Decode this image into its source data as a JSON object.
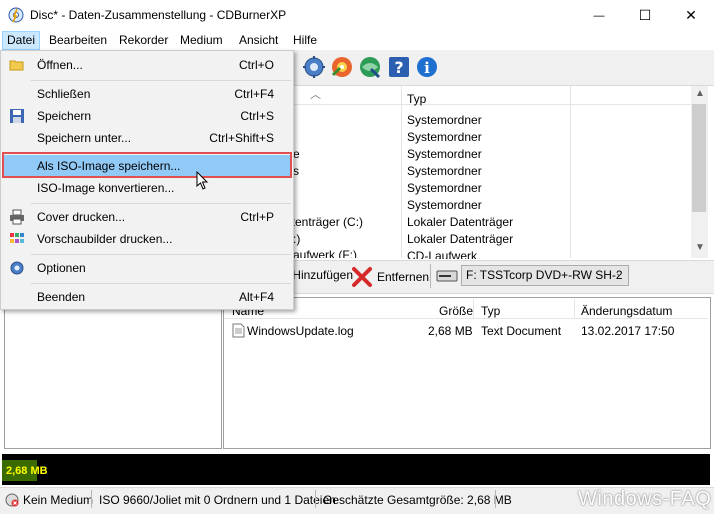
{
  "window": {
    "title": "Disc* - Daten-Zusammenstellung - CDBurnerXP",
    "minimize": "—",
    "maximize": "☐",
    "close": "✕"
  },
  "menubar": [
    "Datei",
    "Bearbeiten",
    "Rekorder",
    "Medium",
    "Ansicht",
    "Hilfe"
  ],
  "file_menu": [
    {
      "label": "Öffnen...",
      "shortcut": "Ctrl+O",
      "icon": "folder-icon"
    },
    {
      "label": "Schließen",
      "shortcut": "Ctrl+F4",
      "icon": ""
    },
    {
      "label": "Speichern",
      "shortcut": "Ctrl+S",
      "icon": "floppy-icon"
    },
    {
      "label": "Speichern unter...",
      "shortcut": "Ctrl+Shift+S",
      "icon": ""
    },
    {
      "label": "Als ISO-Image speichern...",
      "shortcut": "",
      "icon": ""
    },
    {
      "label": "ISO-Image konvertieren...",
      "shortcut": "",
      "icon": ""
    },
    {
      "label": "Cover drucken...",
      "shortcut": "Ctrl+P",
      "icon": "printer-icon"
    },
    {
      "label": "Vorschaubilder drucken...",
      "shortcut": "",
      "icon": "thumbnails-icon"
    },
    {
      "label": "Optionen",
      "shortcut": "",
      "icon": "gear-icon"
    },
    {
      "label": "Beenden",
      "shortcut": "Alt+F4",
      "icon": ""
    }
  ],
  "upper_list": {
    "column": "Typ",
    "types": [
      "Systemordner",
      "Systemordner",
      "Systemordner",
      "Systemordner",
      "Systemordner",
      "Systemordner",
      "Lokaler Datenträger",
      "Lokaler Datenträger",
      "CD-Laufwerk"
    ],
    "left_fragments": [
      "e",
      "s",
      "atenträger (C:)",
      ":)",
      "aufwerk (F:)"
    ]
  },
  "midbar": {
    "add_label": "Hinzufügen",
    "remove_label": "Entfernen",
    "drive": "F: TSSTcorp DVD+-RW SH-2"
  },
  "lower_list": {
    "headers": {
      "name": "Name",
      "size": "Größe",
      "type": "Typ",
      "date": "Änderungsdatum"
    },
    "rows": [
      {
        "name": "WindowsUpdate.log",
        "size": "2,68 MB",
        "type": "Text Document",
        "date": "13.02.2017 17:50"
      }
    ]
  },
  "capacity": {
    "label": "2,68 MB",
    "fill_fraction": 0.005
  },
  "status": {
    "medium": "Kein Medium",
    "fs": "ISO 9660/Joliet mit 0 Ordnern und 1 Dateien",
    "size": "Geschätzte Gesamtgröße: 2,68 MB"
  },
  "watermark": "Windows-FAQ",
  "colors": {
    "highlight": "#91c9f7",
    "callout": "#e05050",
    "capacity_bg": "#000000",
    "capacity_text": "#ffff00"
  }
}
